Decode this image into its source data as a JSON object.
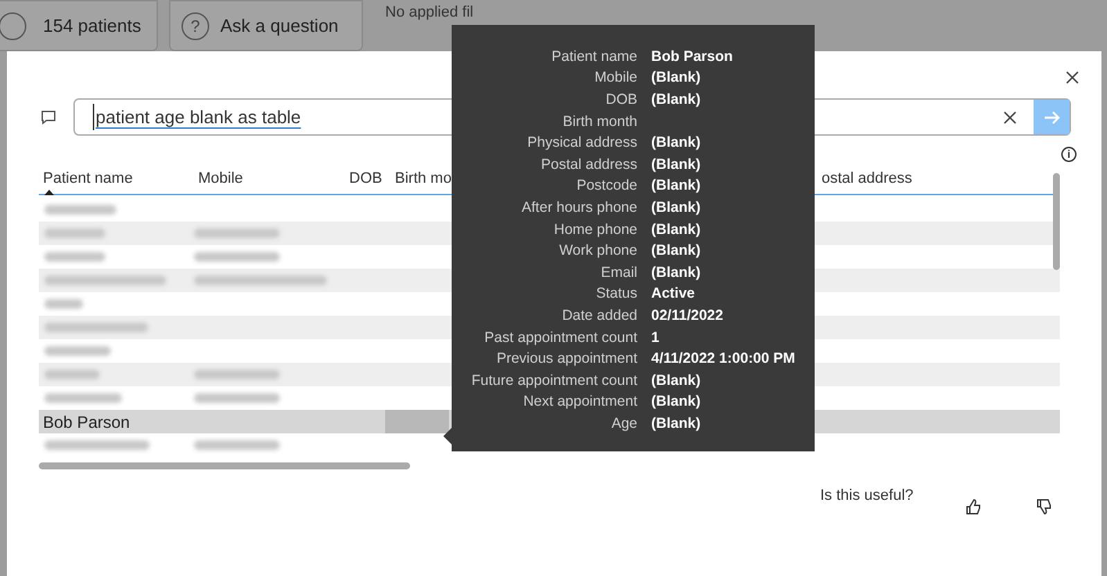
{
  "top_bar": {
    "patients_tab": "154 patients",
    "ask_tab": "Ask a question",
    "help_icon": "?",
    "filters": "No applied fil"
  },
  "dialog": {
    "info_icon": "i",
    "query": {
      "value": "patient age blank as table"
    },
    "table": {
      "columns": [
        "Patient name",
        "Mobile",
        "DOB",
        "Birth mo",
        "ostal address"
      ],
      "rows": [
        {
          "kind": "redacted",
          "mobile": false,
          "selected": false
        },
        {
          "kind": "redacted",
          "mobile": true,
          "selected": false
        },
        {
          "kind": "redacted",
          "mobile": true,
          "selected": false
        },
        {
          "kind": "redacted",
          "mobile": true,
          "selected": false
        },
        {
          "kind": "redacted",
          "mobile": false,
          "selected": false
        },
        {
          "kind": "redacted",
          "mobile": false,
          "selected": false
        },
        {
          "kind": "redacted",
          "mobile": false,
          "selected": false
        },
        {
          "kind": "redacted",
          "mobile": true,
          "selected": false
        },
        {
          "kind": "redacted",
          "mobile": true,
          "selected": false
        },
        {
          "kind": "text",
          "name": "Bob Parson",
          "selected": true
        },
        {
          "kind": "redacted",
          "mobile": true,
          "selected": false
        }
      ]
    },
    "feedback": {
      "question": "Is this useful?"
    }
  },
  "tooltip": {
    "fields": [
      {
        "label": "Patient name",
        "value": "Bob Parson"
      },
      {
        "label": "Mobile",
        "value": "(Blank)"
      },
      {
        "label": "DOB",
        "value": "(Blank)"
      },
      {
        "label": "Birth month"
      },
      {
        "label": "Physical address",
        "value": "(Blank)"
      },
      {
        "label": "Postal address",
        "value": "(Blank)"
      },
      {
        "label": "Postcode",
        "value": "(Blank)"
      },
      {
        "label": "After hours phone",
        "value": "(Blank)"
      },
      {
        "label": "Home phone",
        "value": "(Blank)"
      },
      {
        "label": "Work phone",
        "value": "(Blank)"
      },
      {
        "label": "Email",
        "value": "(Blank)"
      },
      {
        "label": "Status",
        "value": "Active"
      },
      {
        "label": "Date added",
        "value": "02/11/2022"
      },
      {
        "label": "Past appointment count",
        "value": "1"
      },
      {
        "label": "Previous appointment",
        "value": "4/11/2022 1:00:00 PM"
      },
      {
        "label": "Future appointment count",
        "value": "(Blank)"
      },
      {
        "label": "Next appointment",
        "value": "(Blank)"
      },
      {
        "label": "Age",
        "value": "(Blank)"
      }
    ]
  }
}
